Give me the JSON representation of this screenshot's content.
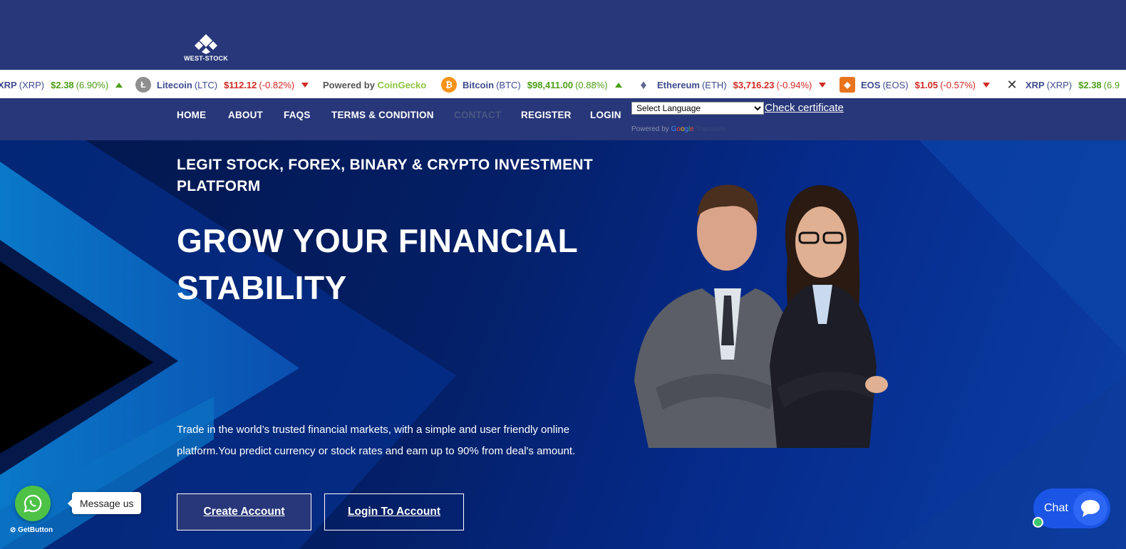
{
  "brand": {
    "logo_text": "WEST-STOCK"
  },
  "ticker": [
    {
      "name": "XRP",
      "symbol": "(XRP)",
      "price": "$2.38",
      "change": "(6.90%)",
      "direction": "up",
      "icon": "xrp-icon"
    },
    {
      "name": "Litecoin",
      "symbol": "(LTC)",
      "price": "$112.12",
      "change": "(-0.82%)",
      "direction": "down",
      "icon": "litecoin-icon"
    },
    {
      "powered_prefix": "Powered by",
      "powered_brand": "CoinGecko"
    },
    {
      "name": "Bitcoin",
      "symbol": "(BTC)",
      "price": "$98,411.00",
      "change": "(0.88%)",
      "direction": "up",
      "icon": "bitcoin-icon"
    },
    {
      "name": "Ethereum",
      "symbol": "(ETH)",
      "price": "$3,716.23",
      "change": "(-0.94%)",
      "direction": "down",
      "icon": "ethereum-icon"
    },
    {
      "name": "EOS",
      "symbol": "(EOS)",
      "price": "$1.05",
      "change": "(-0.57%)",
      "direction": "down",
      "icon": "eos-icon"
    },
    {
      "name": "XRP",
      "symbol": "(XRP)",
      "price": "$2.38",
      "change": "(6.9",
      "direction": "up",
      "icon": "xrp-icon"
    }
  ],
  "nav": {
    "items": [
      "HOME",
      "ABOUT",
      "FAQS",
      "TERMS & CONDITION",
      "CONTACT",
      "REGISTER",
      "LOGIN"
    ],
    "active": "CONTACT",
    "language_select": "Select Language",
    "check_certificate": "Check certificate",
    "translate": {
      "powered_by": "Powered by",
      "google": [
        "G",
        "o",
        "o",
        "g",
        "l",
        "e"
      ],
      "translate": "Translate"
    }
  },
  "hero": {
    "tagline": "LEGIT STOCK, FOREX, BINARY & CRYPTO INVESTMENT PLATFORM",
    "headline": "GROW YOUR FINANCIAL STABILITY",
    "description": "Trade in the world’s trusted financial markets, with a simple and user friendly online platform.You predict currency or stock rates and earn up to 90% from deal's amount.",
    "create_account": "Create Account",
    "login_account": "Login To Account"
  },
  "widgets": {
    "whatsapp_message": "Message us",
    "getbutton": "GetButton",
    "chat_label": "Chat"
  },
  "colors": {
    "header": "#283779",
    "up": "#4b9e16",
    "down": "#d22a24",
    "whatsapp": "#4dc247",
    "chat": "#1b55e6"
  }
}
